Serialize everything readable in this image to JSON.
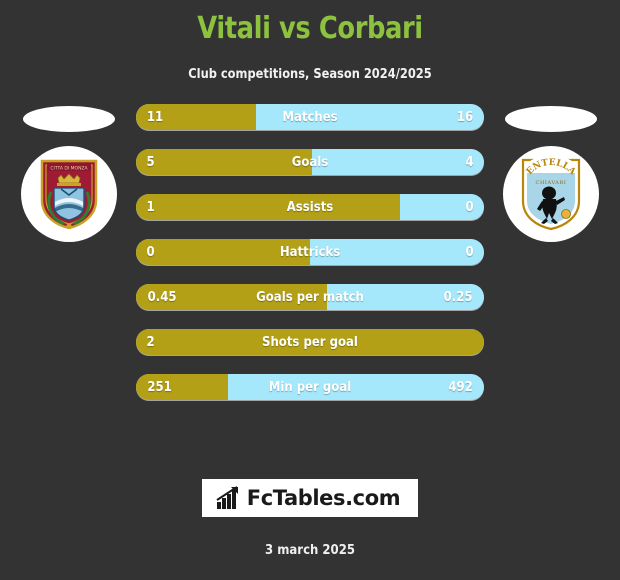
{
  "header": {
    "title": "Vitali vs Corbari",
    "subtitle": "Club competitions, Season 2024/2025",
    "title_color": "#8dc23f"
  },
  "teams": {
    "home": {
      "crest_name": "home-club-crest",
      "crest_description": "Red shield crest with crown and wreath"
    },
    "away": {
      "crest_name": "away-club-crest",
      "crest_description": "Entella Chiavari light blue shield crest",
      "crest_text_top": "ENTELLA",
      "crest_text_bottom": "CHIAVARI"
    }
  },
  "colors": {
    "home_bar": "#b3a016",
    "away_bar": "#a5e8fb",
    "background": "#333333",
    "accent_green": "#8dc23f"
  },
  "stats": [
    {
      "label": "Matches",
      "home": "11",
      "away": "16",
      "home_pct": 34.5
    },
    {
      "label": "Goals",
      "home": "5",
      "away": "4",
      "home_pct": 50.6
    },
    {
      "label": "Assists",
      "home": "1",
      "away": "0",
      "home_pct": 76.0
    },
    {
      "label": "Hattricks",
      "home": "0",
      "away": "0",
      "home_pct": 50.0
    },
    {
      "label": "Goals per match",
      "home": "0.45",
      "away": "0.25",
      "home_pct": 55.0
    },
    {
      "label": "Shots per goal",
      "home": "2",
      "away": "",
      "home_pct": 100.0
    },
    {
      "label": "Min per goal",
      "home": "251",
      "away": "492",
      "home_pct": 26.4
    }
  ],
  "footer": {
    "brand": "FcTables.com",
    "brand_icon": "bar-chart-icon",
    "date": "3 march 2025"
  }
}
